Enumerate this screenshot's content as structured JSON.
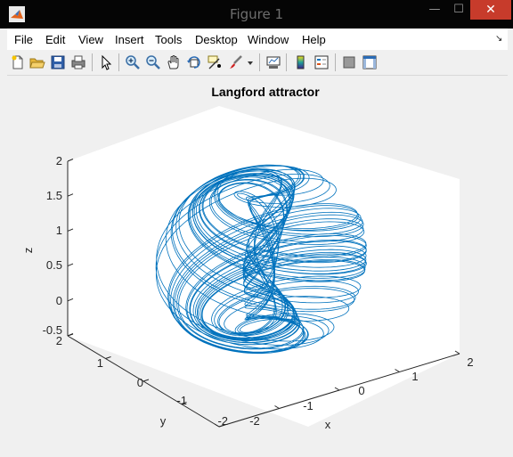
{
  "window": {
    "title": "Figure 1",
    "minimize_glyph": "—",
    "maximize_glyph": "☐",
    "close_glyph": "✕"
  },
  "menu": [
    "File",
    "Edit",
    "View",
    "Insert",
    "Tools",
    "Desktop",
    "Window",
    "Help"
  ],
  "toolbar": [
    "new-figure-icon",
    "open-file-icon",
    "save-icon",
    "print-icon",
    "edit-plot-arrow-icon",
    "zoom-in-icon",
    "zoom-out-icon",
    "pan-hand-icon",
    "rotate-3d-icon",
    "data-cursor-icon",
    "brush-icon",
    "brush-dropdown-icon",
    "link-plot-icon",
    "insert-colorbar-icon",
    "insert-legend-icon",
    "hide-plot-tools-icon",
    "show-plot-tools-icon"
  ],
  "chart_data": {
    "type": "line",
    "view": "3d",
    "title": "Langford attractor",
    "xlabel": "x",
    "ylabel": "y",
    "zlabel": "z",
    "xlim": [
      -2,
      2
    ],
    "ylim": [
      -2,
      2
    ],
    "zlim": [
      -0.5,
      2
    ],
    "xticks": [
      "-2",
      "-1",
      "0",
      "1",
      "2"
    ],
    "yticks": [
      "-2",
      "-1",
      "0",
      "1",
      "2"
    ],
    "zticks": [
      "-0.5",
      "0",
      "0.5",
      "1",
      "1.5",
      "2"
    ],
    "line_color": "#0072bd",
    "grid": false
  }
}
